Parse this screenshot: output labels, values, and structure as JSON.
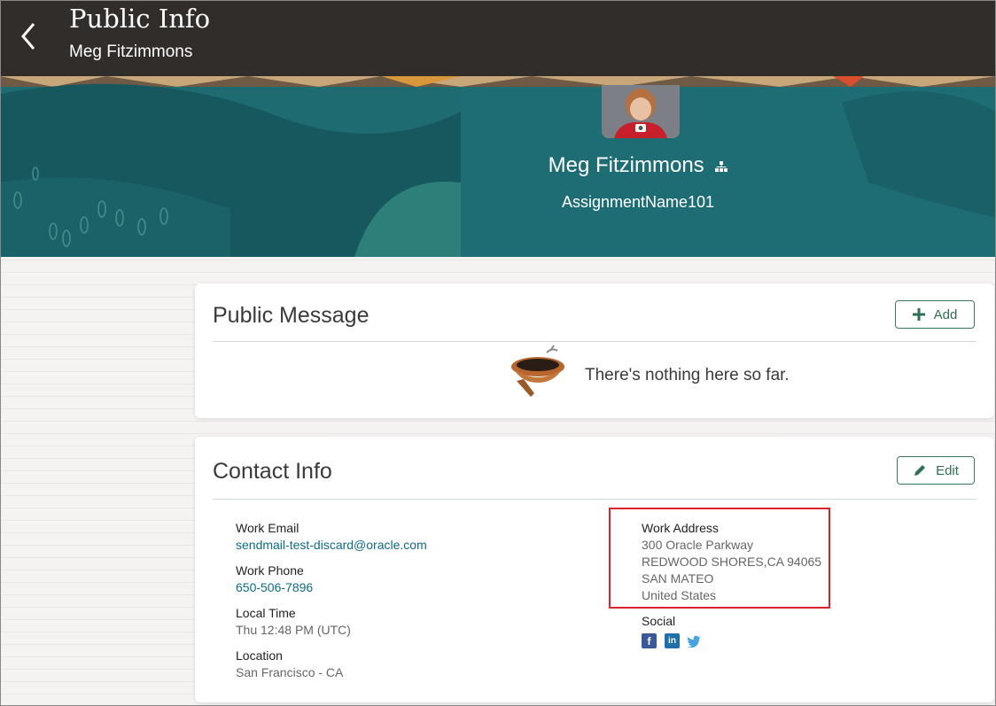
{
  "header": {
    "title": "Public Info",
    "subtitle": "Meg Fitzimmons"
  },
  "profile": {
    "name": "Meg Fitzimmons",
    "assignment": "AssignmentName101"
  },
  "public_message": {
    "title": "Public Message",
    "add_label": "Add",
    "empty_text": "There's nothing here so far."
  },
  "contact_info": {
    "title": "Contact Info",
    "edit_label": "Edit",
    "work_email_label": "Work Email",
    "work_email": "sendmail-test-discard@oracle.com",
    "work_phone_label": "Work Phone",
    "work_phone": "650-506-7896",
    "local_time_label": "Local Time",
    "local_time": "Thu 12:48 PM (UTC)",
    "location_label": "Location",
    "location": "San Francisco - CA",
    "work_address_label": "Work Address",
    "address_lines": [
      "300 Oracle Parkway",
      "REDWOOD SHORES,CA 94065",
      "SAN MATEO",
      "United States"
    ],
    "social_label": "Social",
    "social_icons": [
      "facebook-icon",
      "linkedin-icon",
      "twitter-icon"
    ]
  },
  "colors": {
    "header_bg": "#312d2a",
    "banner_teal": "#1f6b72",
    "accent_green": "#2f6f54",
    "link_blue": "#0e6b86",
    "highlight_red": "#d9252a"
  }
}
